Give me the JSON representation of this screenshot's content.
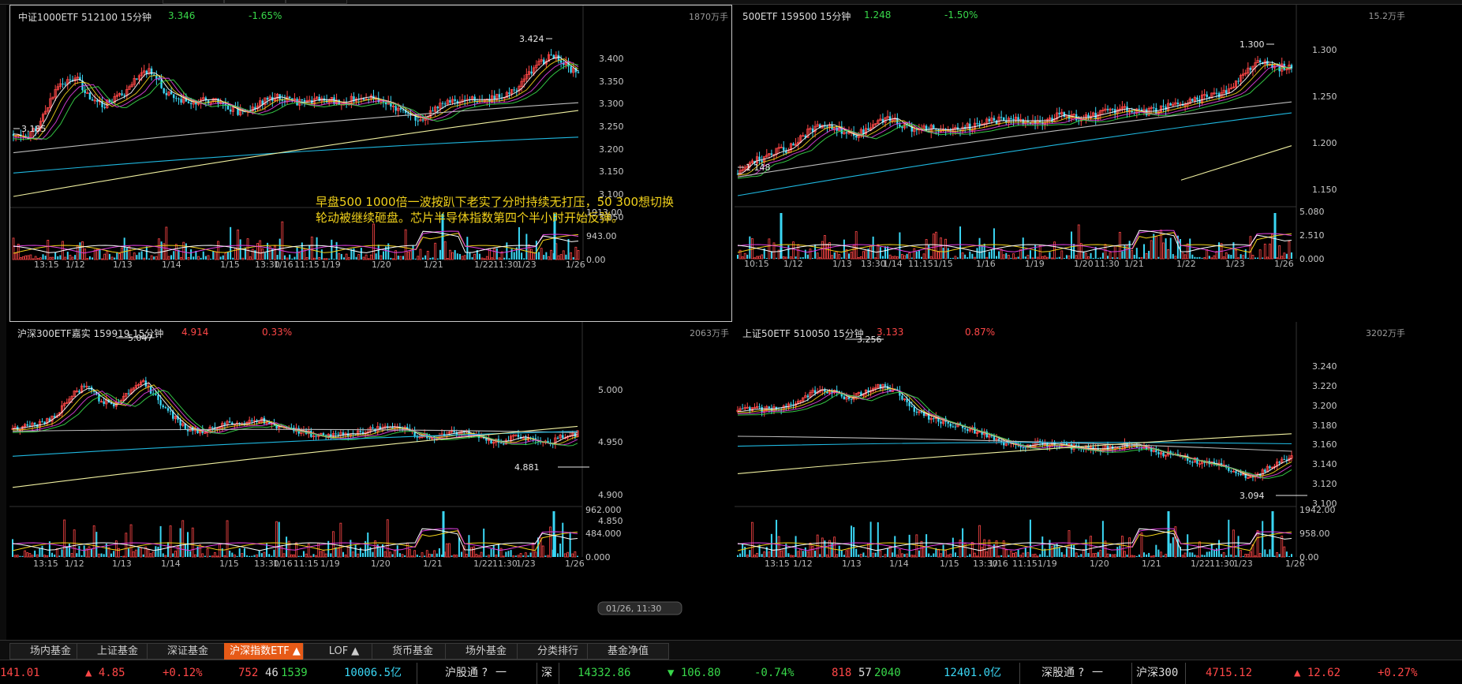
{
  "panels": [
    {
      "id": "p1",
      "title": "中证1000ETF 512100 15分钟",
      "price": "3.346",
      "change_pct": "-1.65%",
      "change_color": "green",
      "volume_unit": "1870万手",
      "price_axis": [
        "3.400",
        "3.350",
        "3.300",
        "3.250",
        "3.200",
        "3.150",
        "3.100",
        "3.050"
      ],
      "vol_axis": [
        "1913.00",
        "943.00",
        "0.00"
      ],
      "dates": [
        "13:15",
        "1/12",
        "1/13",
        "1/14",
        "1/15",
        "13:30",
        "1/16",
        "11:15",
        "1/19",
        "1/20",
        "1/21",
        "1/22",
        "11:30",
        "1/23",
        "1/26"
      ],
      "high_label": "3.424",
      "low_label": "3.185"
    },
    {
      "id": "p2",
      "title": "500ETF 159500 15分钟",
      "price": "1.248",
      "change_pct": "-1.50%",
      "change_color": "green",
      "volume_unit": "15.2万手",
      "price_axis": [
        "1.300",
        "1.250",
        "1.200",
        "1.150"
      ],
      "vol_axis": [
        "5.080",
        "2.510",
        "0.000"
      ],
      "dates": [
        "10:15",
        "1/12",
        "1/13",
        "13:30",
        "1/14",
        "11:15",
        "1/15",
        "1/16",
        "1/19",
        "1/20",
        "11:30",
        "1/21",
        "1/22",
        "1/23",
        "1/26"
      ],
      "high_label": "1.300",
      "low_label": "1.148"
    },
    {
      "id": "p3",
      "title": "沪深300ETF嘉实 159919 15分钟",
      "price": "4.914",
      "change_pct": "0.33%",
      "change_color": "red",
      "volume_unit": "2063万手",
      "price_axis": [
        "5.000",
        "4.950",
        "4.900",
        "4.850"
      ],
      "vol_axis": [
        "962.000",
        "484.000",
        "0.000"
      ],
      "dates": [
        "13:15",
        "1/12",
        "1/13",
        "1/14",
        "1/15",
        "13:30",
        "1/16",
        "11:15",
        "1/19",
        "1/20",
        "1/21",
        "1/22",
        "11:30",
        "1/23",
        "1/26"
      ],
      "high_label": "5.047",
      "low_label": "4.881",
      "cursor_time": "01/26, 11:30"
    },
    {
      "id": "p4",
      "title": "上证50ETF 510050 15分钟",
      "price": "3.133",
      "change_pct": "0.87%",
      "change_color": "red",
      "volume_unit": "3202万手",
      "price_axis": [
        "3.240",
        "3.220",
        "3.200",
        "3.180",
        "3.160",
        "3.140",
        "3.120",
        "3.100"
      ],
      "vol_axis": [
        "1942.00",
        "958.00",
        "0.00"
      ],
      "dates": [
        "13:15",
        "1/12",
        "1/13",
        "1/14",
        "1/15",
        "13:30",
        "1/16",
        "11:15",
        "1/19",
        "1/20",
        "1/21",
        "1/22",
        "11:30",
        "1/23",
        "1/26"
      ],
      "high_label": "3.256",
      "low_label": "3.094"
    }
  ],
  "annotation": {
    "line1": "早盘500 1000倍一波按趴下老实了分时持续无打压，50 300想切换",
    "line2": "轮动被继续砸盘。芯片半导体指数第四个半小时开始反弹。"
  },
  "tabs": [
    "场内基金",
    "上证基金",
    "深证基金",
    "沪深指数ETF ▲",
    "LOF ▲",
    "货币基金",
    "场外基金",
    "分类排行",
    "基金净值"
  ],
  "active_tab": 3,
  "ticker": {
    "sh_index_partial": "141.01",
    "sh_change": "▲ 4.85",
    "sh_pct": "+0.12%",
    "sh_up": "752",
    "sh_flat": "46",
    "sh_down": "1539",
    "sh_amount": "10006.5亿",
    "sh_connect": "沪股通",
    "sh_connect_icon": "question-circle-icon",
    "sh_connect_val": "一",
    "sz_label": "深",
    "sz_index": "14332.86",
    "sz_change": "▼ 106.80",
    "sz_pct": "-0.74%",
    "sz_up": "818",
    "sz_flat": "57",
    "sz_down": "2040",
    "sz_amount": "12401.0亿",
    "sz_connect": "深股通",
    "sz_connect_val": "一",
    "hs300_label": "沪深300",
    "hs300_index": "4715.12",
    "hs300_change": "▲ 12.62",
    "hs300_pct": "+0.27%"
  },
  "colors": {
    "up": "#ff4747",
    "down": "#38d84a",
    "candle_down": "#3ad7f5",
    "active_tab": "#e65a17",
    "annotation": "#f2d21b",
    "ma5": "#ffffff",
    "ma10": "#f2d21b",
    "ma20": "#e040e0",
    "ma30": "#38d84a",
    "ma60": "#bbbbbb",
    "ma120": "#1fb8e0",
    "ma250": "#f0f0a0"
  }
}
